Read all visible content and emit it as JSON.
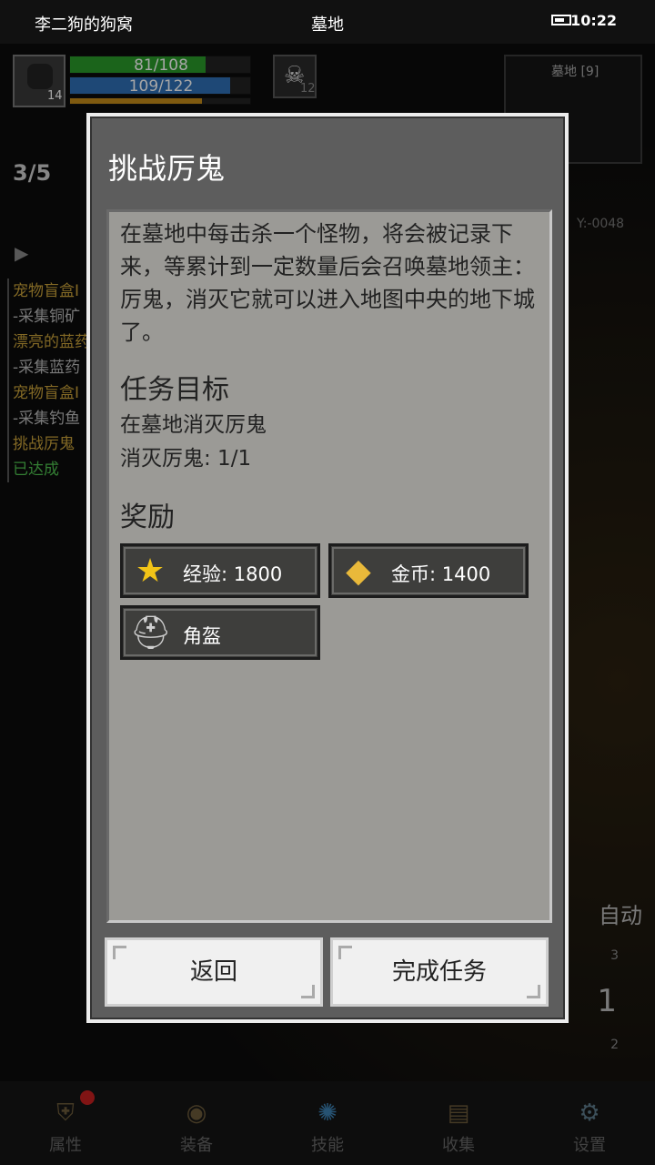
{
  "status_bar": {
    "left": "李二狗的狗窝",
    "title": "墓地",
    "time": "10:22"
  },
  "hud": {
    "player_level": "14",
    "hp_text": "81/108",
    "hp": 0.75,
    "mp_text": "109/122",
    "mp": 0.89,
    "xp": 0.73,
    "enemy_level": "12",
    "minimap_label": "墓地 [9]",
    "coord": "Y:-0048",
    "kill_count": "3/5"
  },
  "quest_list": [
    {
      "text": "宠物盲盒I",
      "color": "gold"
    },
    {
      "text": "-采集铜矿",
      "color": "grey"
    },
    {
      "text": "漂亮的蓝药",
      "color": "gold"
    },
    {
      "text": "-采集蓝药",
      "color": "grey"
    },
    {
      "text": "宠物盲盒I",
      "color": "gold"
    },
    {
      "text": "-采集钓鱼",
      "color": "grey"
    },
    {
      "text": "挑战厉鬼",
      "color": "gold"
    },
    {
      "text": "已达成",
      "color": "green"
    }
  ],
  "side": {
    "auto_label": "自动",
    "floor_number": "1",
    "floor_up": "3",
    "floor_down": "2"
  },
  "dialog": {
    "title": "挑战厉鬼",
    "description": "在墓地中每击杀一个怪物，将会被记录下来，等累计到一定数量后会召唤墓地领主：厉鬼，消灭它就可以进入地图中央的地下城了。",
    "objective_title": "任务目标",
    "objective_lines": [
      "在墓地消灭厉鬼",
      "消灭厉鬼: 1/1"
    ],
    "reward_title": "奖励",
    "rewards": [
      {
        "icon": "star-icon",
        "label": "经验: 1800"
      },
      {
        "icon": "gold-coins-icon",
        "label": "金币: 1400"
      },
      {
        "icon": "helmet-icon",
        "label": "角盔"
      }
    ],
    "back_label": "返回",
    "complete_label": "完成任务"
  },
  "bottom_nav": [
    {
      "label": "属性",
      "icon": "armor-icon"
    },
    {
      "label": "装备",
      "icon": "bag-icon"
    },
    {
      "label": "技能",
      "icon": "skill-icon"
    },
    {
      "label": "收集",
      "icon": "book-icon"
    },
    {
      "label": "设置",
      "icon": "gear-icon"
    }
  ]
}
